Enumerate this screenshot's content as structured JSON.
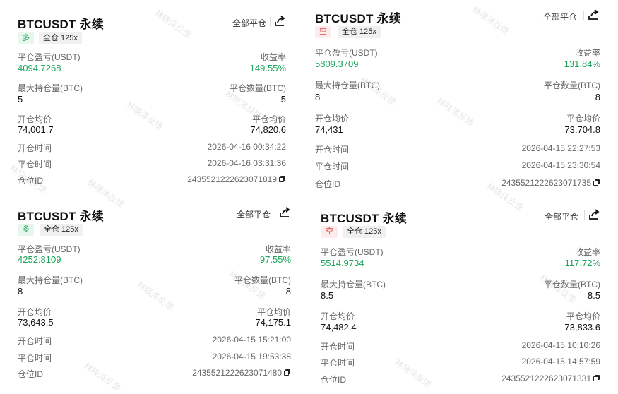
{
  "cards": [
    {
      "title": "BTCUSDT 永续",
      "close_all": "全部平仓",
      "side": "多",
      "margin": "全仓 125x",
      "pnl_label": "平仓盈亏(USDT)",
      "pnl": "4094.7268",
      "roi_label": "收益率",
      "roi": "149.55%",
      "max_pos_label": "最大持仓量(BTC)",
      "max_pos": "5",
      "close_qty_label": "平仓数量(BTC)",
      "close_qty": "5",
      "open_avg_label": "开仓均价",
      "open_avg": "74,001.7",
      "close_avg_label": "平仓均价",
      "close_avg": "74,820.6",
      "open_time_label": "开仓时间",
      "open_time": "2026-04-16 00:34:22",
      "close_time_label": "平仓时间",
      "close_time": "2026-04-16 03:31:36",
      "id_label": "仓位ID",
      "id": "2435521222623071819"
    },
    {
      "title": "BTCUSDT 永续",
      "close_all": "全部平仓",
      "side": "空",
      "margin": "全仓 125x",
      "pnl_label": "平仓盈亏(USDT)",
      "pnl": "5809.3709",
      "roi_label": "收益率",
      "roi": "131.84%",
      "max_pos_label": "最大持仓量(BTC)",
      "max_pos": "8",
      "close_qty_label": "平仓数量(BTC)",
      "close_qty": "8",
      "open_avg_label": "开仓均价",
      "open_avg": "74,431",
      "close_avg_label": "平仓均价",
      "close_avg": "73,704.8",
      "open_time_label": "开仓时间",
      "open_time": "2026-04-15 22:27:53",
      "close_time_label": "平仓时间",
      "close_time": "2026-04-15 23:30:54",
      "id_label": "仓位ID",
      "id": "2435521222623071735"
    },
    {
      "title": "BTCUSDT 永续",
      "close_all": "全部平仓",
      "side": "多",
      "margin": "全仓 125x",
      "pnl_label": "平仓盈亏(USDT)",
      "pnl": "4252.8109",
      "roi_label": "收益率",
      "roi": "97.55%",
      "max_pos_label": "最大持仓量(BTC)",
      "max_pos": "8",
      "close_qty_label": "平仓数量(BTC)",
      "close_qty": "8",
      "open_avg_label": "开仓均价",
      "open_avg": "73,643.5",
      "close_avg_label": "平仓均价",
      "close_avg": "74,175.1",
      "open_time_label": "开仓时间",
      "open_time": "2026-04-15 15:21:00",
      "close_time_label": "平仓时间",
      "close_time": "2026-04-15 19:53:38",
      "id_label": "仓位ID",
      "id": "2435521222623071480"
    },
    {
      "title": "BTCUSDT 永续",
      "close_all": "全部平仓",
      "side": "空",
      "margin": "全仓 125x",
      "pnl_label": "平仓盈亏(USDT)",
      "pnl": "5514.9734",
      "roi_label": "收益率",
      "roi": "117.72%",
      "max_pos_label": "最大持仓量(BTC)",
      "max_pos": "8.5",
      "close_qty_label": "平仓数量(BTC)",
      "close_qty": "8.5",
      "open_avg_label": "开仓均价",
      "open_avg": "74,482.4",
      "close_avg_label": "平仓均价",
      "close_avg": "73,833.6",
      "open_time_label": "开仓时间",
      "open_time": "2026-04-15 10:10:26",
      "close_time_label": "平仓时间",
      "close_time": "2026-04-15 14:57:59",
      "id_label": "仓位ID",
      "id": "2435521222623071331"
    }
  ],
  "watermark": "林晓泽反馈",
  "icons": {
    "share": "share-icon",
    "copy": "copy-icon"
  },
  "colors": {
    "profit": "#1aa55b",
    "short": "#e0474c",
    "long_bg": "#e8f7ee",
    "short_bg": "#fdecec"
  }
}
